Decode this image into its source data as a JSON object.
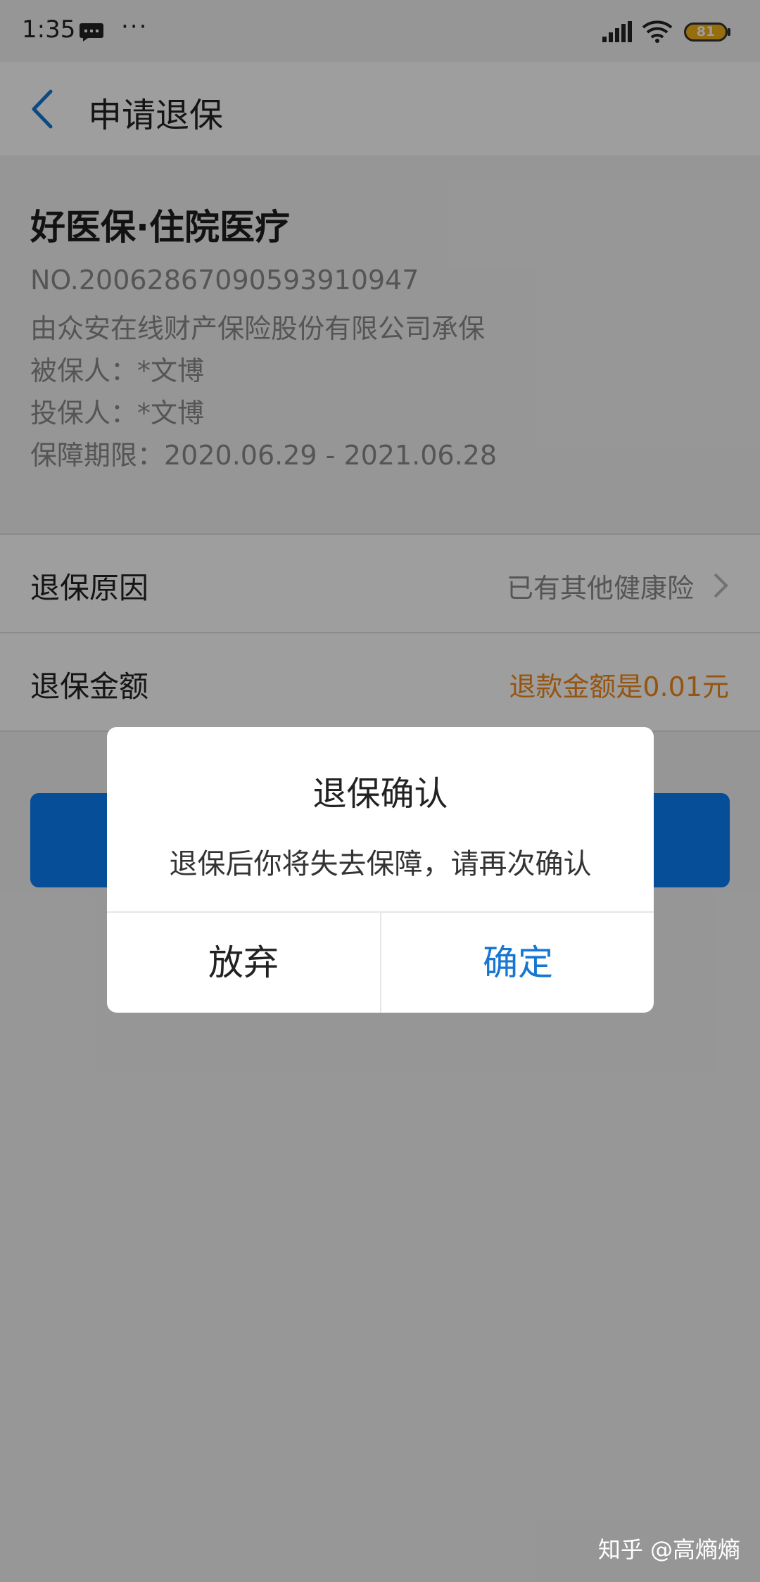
{
  "status_bar": {
    "time": "1:35",
    "more": "···",
    "battery": "81"
  },
  "nav": {
    "title": "申请退保"
  },
  "policy": {
    "product": "好医保·住院医疗",
    "number": "NO.20062867090593910947",
    "insurer": "由众安在线财产保险股份有限公司承保",
    "insured": "被保人：*文博",
    "holder": "投保人：*文博",
    "period": "保障期限：2020.06.29 - 2021.06.28"
  },
  "rows": {
    "reason_label": "退保原因",
    "reason_value": "已有其他健康险",
    "amount_label": "退保金额",
    "amount_value": "退款金额是0.01元"
  },
  "dialog": {
    "title": "退保确认",
    "message": "退保后你将失去保障，请再次确认",
    "cancel": "放弃",
    "confirm": "确定"
  },
  "watermark": "知乎 @高熵熵",
  "colors": {
    "accent": "#0a7ff5",
    "confirm": "#1677d2",
    "amount": "#f08a1c",
    "battery": "#f2b21b"
  }
}
